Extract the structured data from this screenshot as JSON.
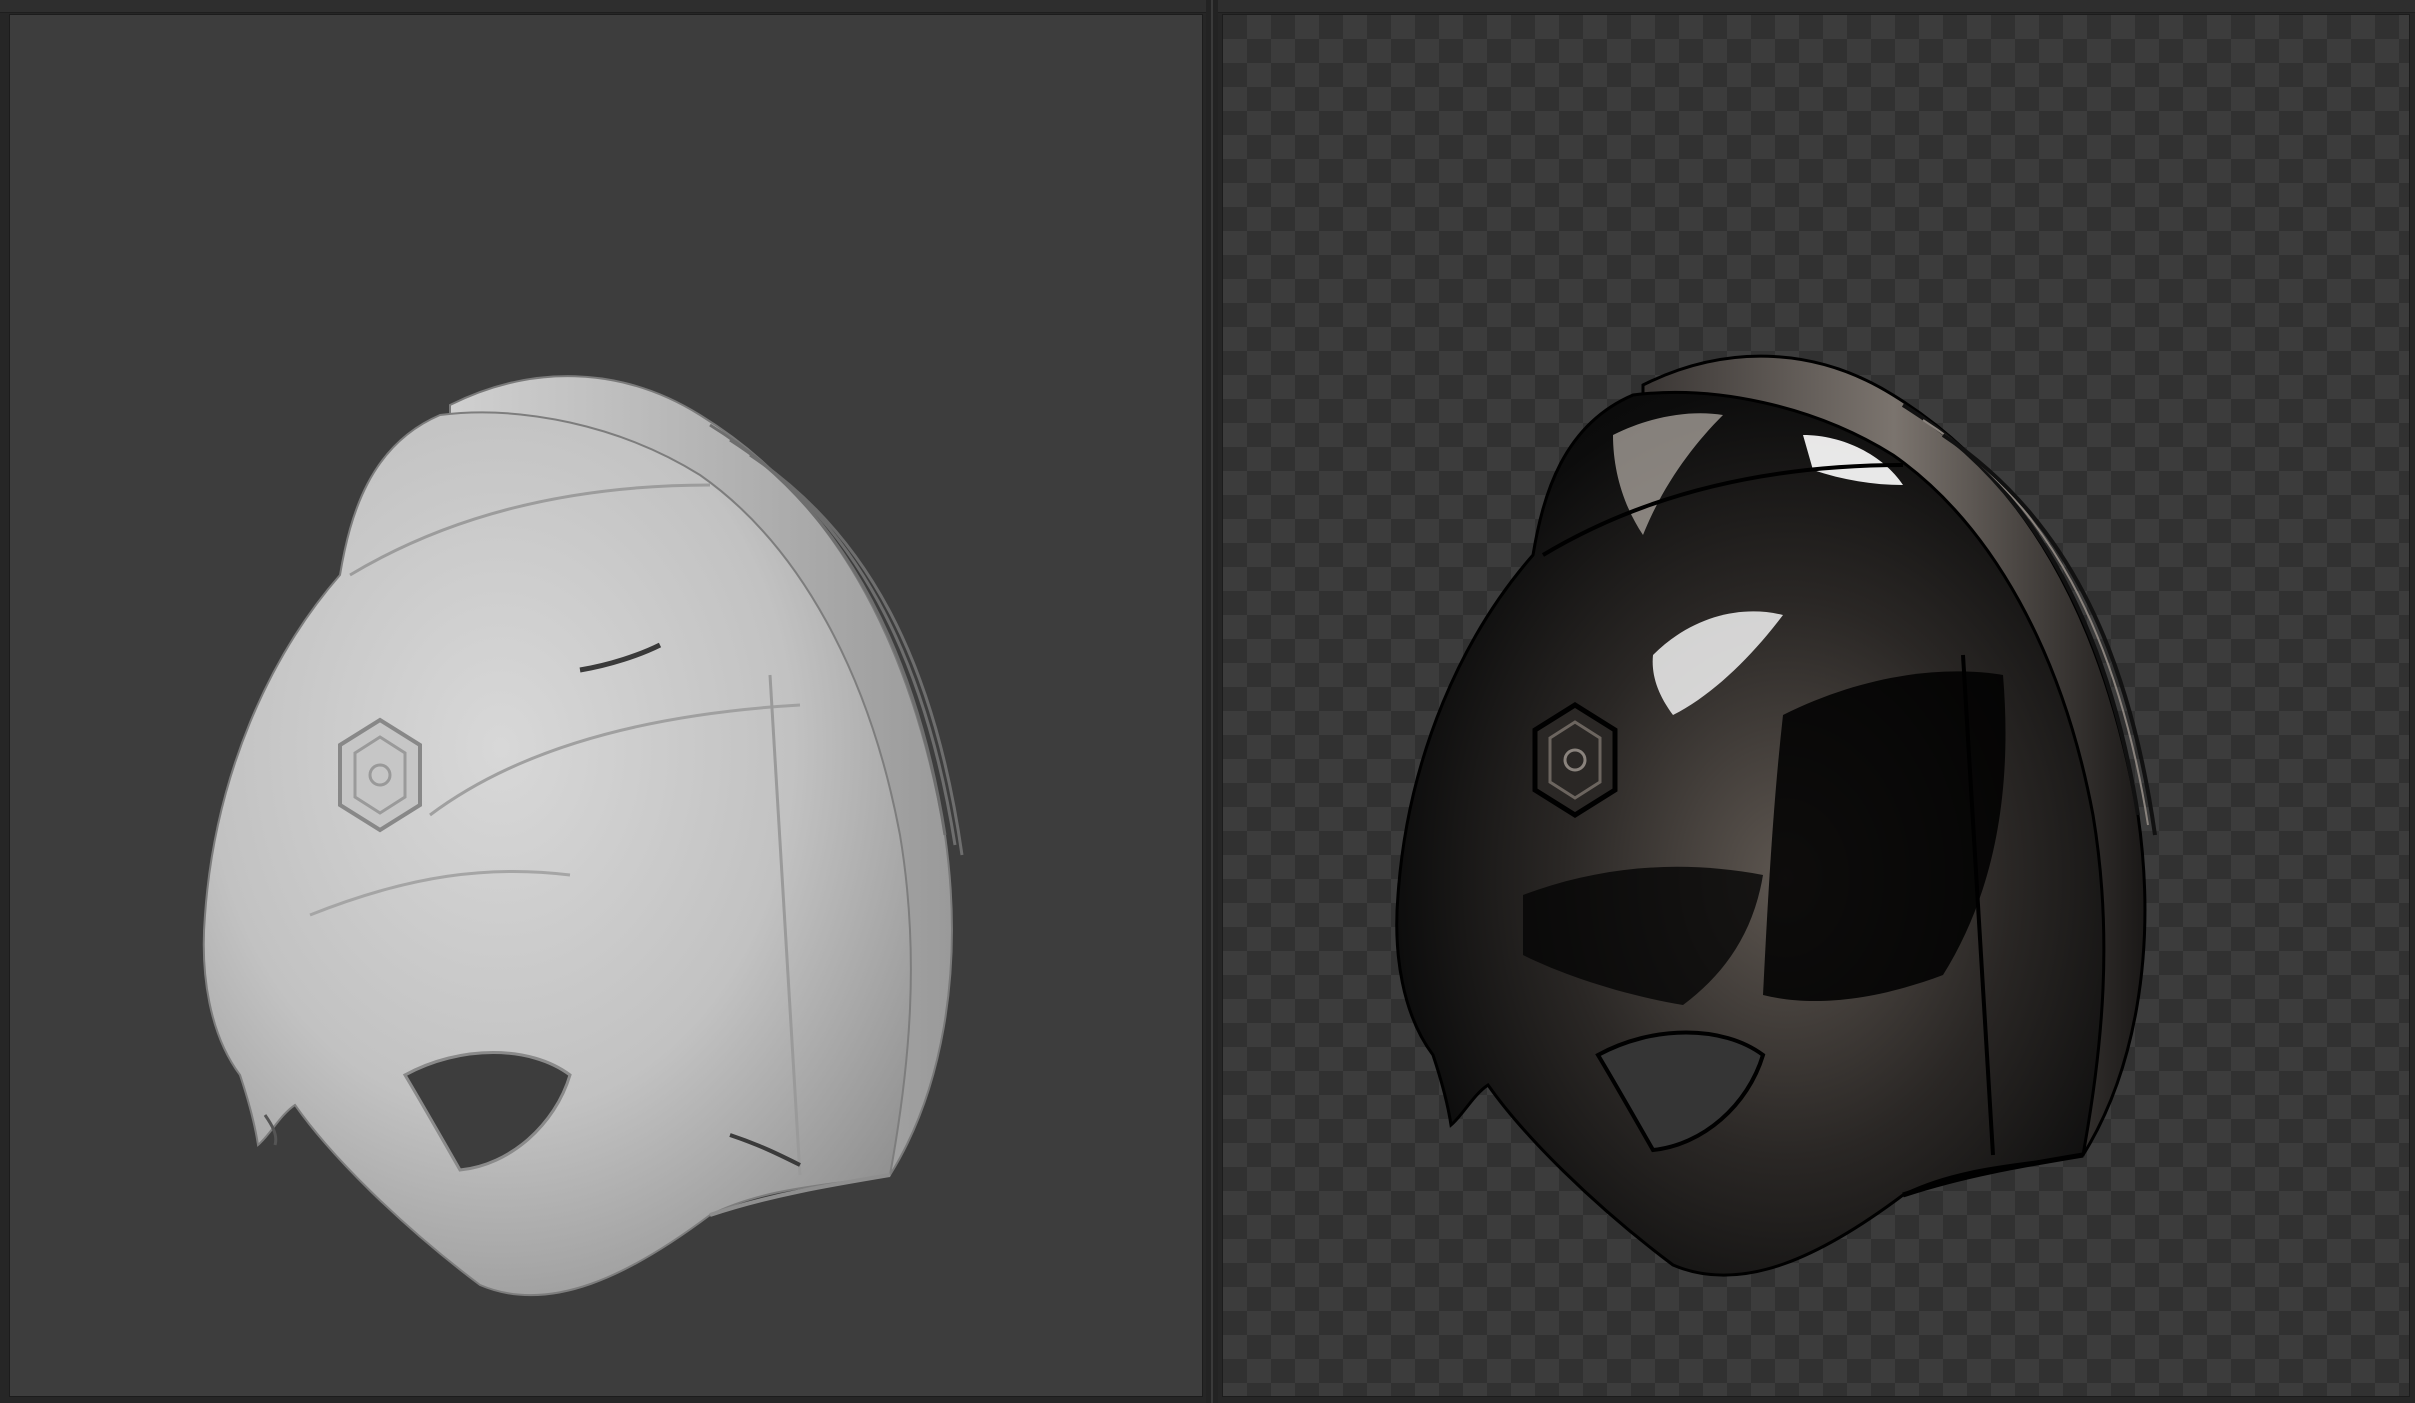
{
  "window": {
    "title": ""
  },
  "viewports": [
    {
      "name": "solid-viewport",
      "shading": "solid-clay",
      "object": "helmet-model"
    },
    {
      "name": "rendered-viewport",
      "shading": "rendered-chrome",
      "background": "transparent-checkerboard",
      "object": "helmet-model"
    }
  ],
  "colors": {
    "viewport_bg": "#3d3d3d",
    "clay": "#c8c8c8",
    "chrome_dark": "#0a0a0a",
    "chrome_mid": "#6a625c",
    "checker_light": "#3c3c3c",
    "checker_dark": "#313131"
  },
  "icons": [
    "hexagon-emblem-icon"
  ]
}
